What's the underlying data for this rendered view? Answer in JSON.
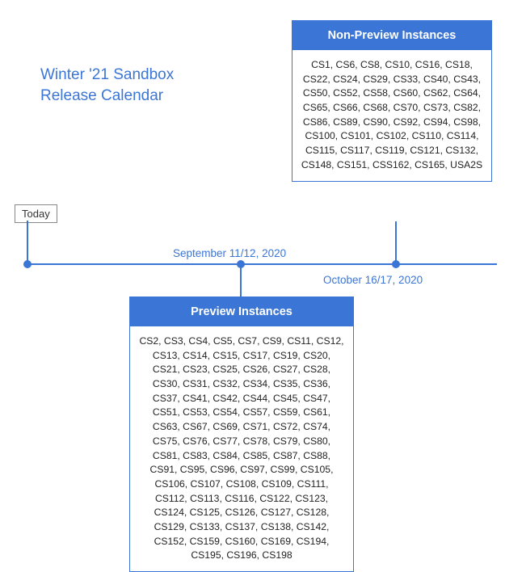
{
  "title_line1": "Winter '21 Sandbox",
  "title_line2": "Release Calendar",
  "today_label": "Today",
  "dates": {
    "preview": "September 11/12, 2020",
    "nonpreview": "October 16/17, 2020"
  },
  "boxes": {
    "nonpreview": {
      "header": "Non-Preview Instances",
      "items": [
        "CS1",
        "CS6",
        "CS8",
        "CS10",
        "CS16",
        "CS18",
        "CS22",
        "CS24",
        "CS29",
        "CS33",
        "CS40",
        "CS43",
        "CS50",
        "CS52",
        "CS58",
        "CS60",
        "CS62",
        "CS64",
        "CS65",
        "CS66",
        "CS68",
        "CS70",
        "CS73",
        "CS82",
        "CS86",
        "CS89",
        "CS90",
        "CS92",
        "CS94",
        "CS98",
        "CS100",
        "CS101",
        "CS102",
        "CS110",
        "CS114",
        "CS115",
        "CS117",
        "CS119",
        "CS121",
        "CS132",
        "CS148",
        "CS151",
        "CSS162",
        "CS165",
        "USA2S"
      ]
    },
    "preview": {
      "header": "Preview Instances",
      "items": [
        "CS2",
        "CS3",
        "CS4",
        "CS5",
        "CS7",
        "CS9",
        "CS11",
        "CS12",
        "CS13",
        "CS14",
        "CS15",
        "CS17",
        "CS19",
        "CS20",
        "CS21",
        "CS23",
        "CS25",
        "CS26",
        "CS27",
        "CS28",
        "CS30",
        "CS31",
        "CS32",
        "CS34",
        "CS35",
        "CS36",
        "CS37",
        "CS41",
        "CS42",
        "CS44",
        "CS45",
        "CS47",
        "CS51",
        "CS53",
        "CS54",
        "CS57",
        "CS59",
        "CS61",
        "CS63",
        "CS67",
        "CS69",
        "CS71",
        "CS72",
        "CS74",
        "CS75",
        "CS76",
        "CS77",
        "CS78",
        "CS79",
        "CS80",
        "CS81",
        "CS83",
        "CS84",
        "CS85",
        "CS87",
        "CS88",
        "CS91",
        "CS95",
        "CS96",
        "CS97",
        "CS99",
        "CS105",
        "CS106",
        "CS107",
        "CS108",
        "CS109",
        "CS111",
        "CS112",
        "CS113",
        "CS116",
        "CS122",
        "CS123",
        "CS124",
        "CS125",
        "CS126",
        "CS127",
        "CS128",
        "CS129",
        "CS133",
        "CS137",
        "CS138",
        "CS142",
        "CS152",
        "CS159",
        "CS160",
        "CS169",
        "CS194",
        "CS195",
        "CS196",
        "CS198"
      ]
    }
  },
  "colors": {
    "accent": "#3b76d6"
  }
}
